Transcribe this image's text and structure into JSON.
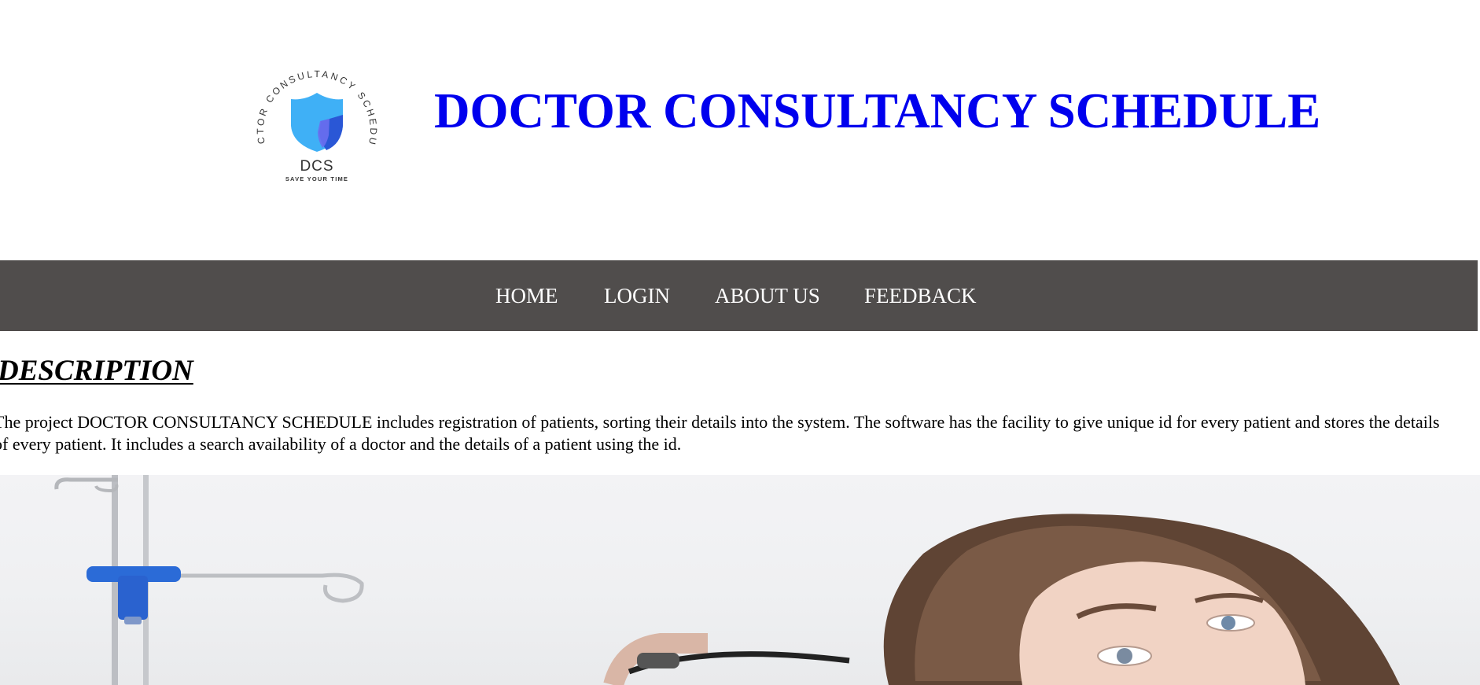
{
  "header": {
    "logo": {
      "ring_text": "DOCTOR CONSULTANCY SCHEDULE",
      "abbr": "DCS",
      "tagline": "SAVE YOUR TIME",
      "icon": "shield-icon"
    },
    "title": "DOCTOR CONSULTANCY SCHEDULE"
  },
  "nav": {
    "items": [
      {
        "label": "HOME"
      },
      {
        "label": "LOGIN"
      },
      {
        "label": "ABOUT US"
      },
      {
        "label": "FEEDBACK"
      }
    ]
  },
  "description": {
    "heading": "DESCRIPTION",
    "text": "The project DOCTOR CONSULTANCY SCHEDULE includes registration of patients, sorting their details into the system. The software has the facility to give unique id for every patient and stores the details of every patient. It includes a search availability of a doctor and the details of a patient using the id."
  },
  "colors": {
    "title": "#0000ee",
    "navbar_bg": "#504d4c",
    "nav_text": "#ffffff",
    "shield_light": "#3fb0f6",
    "shield_dark": "#2a57d6"
  }
}
